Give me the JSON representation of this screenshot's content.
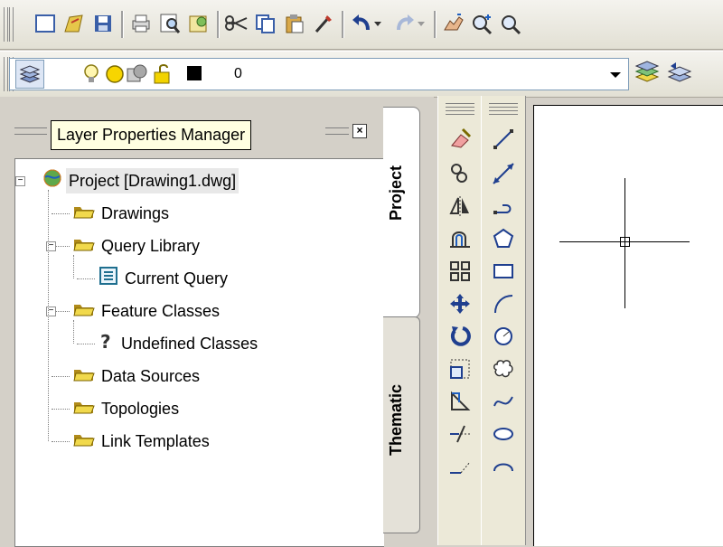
{
  "tooltip": "Layer Properties Manager",
  "layer": {
    "current_name": "0",
    "color_swatch": "#000000"
  },
  "tree": [
    {
      "id": "project",
      "label": "Project [Drawing1.dwg]",
      "icon": "globe-icon",
      "level": 0,
      "expander": "−",
      "selected": true
    },
    {
      "id": "drawings",
      "label": "Drawings",
      "icon": "folder-icon",
      "level": 1,
      "expander": ""
    },
    {
      "id": "query-library",
      "label": "Query Library",
      "icon": "folder-icon",
      "level": 1,
      "expander": "−"
    },
    {
      "id": "current-query",
      "label": "Current Query",
      "icon": "query-icon",
      "level": 2,
      "expander": ""
    },
    {
      "id": "feature-classes",
      "label": "Feature Classes",
      "icon": "folder-icon",
      "level": 1,
      "expander": "−"
    },
    {
      "id": "undefined-classes",
      "label": "Undefined Classes",
      "icon": "question-icon",
      "level": 2,
      "expander": ""
    },
    {
      "id": "data-sources",
      "label": "Data Sources",
      "icon": "folder-icon",
      "level": 1,
      "expander": ""
    },
    {
      "id": "topologies",
      "label": "Topologies",
      "icon": "folder-icon",
      "level": 1,
      "expander": ""
    },
    {
      "id": "link-templates",
      "label": "Link Templates",
      "icon": "folder-icon",
      "level": 1,
      "expander": ""
    }
  ],
  "tabs": {
    "project": "Project",
    "thematic": "Thematic"
  },
  "colors": {
    "folder": "#e8d44a",
    "accent_blue": "#1f5fbf",
    "tooltip_bg": "#ffffe1"
  }
}
